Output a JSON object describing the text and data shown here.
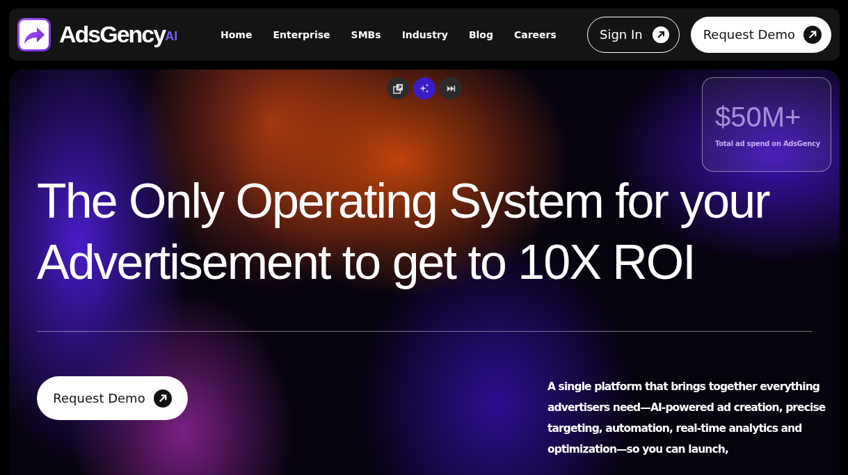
{
  "nav": {
    "brand": "AdsGency",
    "brand_badge": "AI",
    "links": [
      "Home",
      "Enterprise",
      "SMBs",
      "Industry",
      "Blog",
      "Careers"
    ],
    "sign_in": "Sign In",
    "request_demo": "Request Demo"
  },
  "hero": {
    "tools": [
      {
        "kind": "layers",
        "selected": false
      },
      {
        "kind": "sparkle",
        "selected": true
      },
      {
        "kind": "skip",
        "selected": false
      }
    ],
    "stat": {
      "value": "$50M+",
      "label": "Total ad spend on AdsGency"
    },
    "headline": [
      "The Only Operating System for your",
      "Advertisement to get to 10X ROI"
    ],
    "cta": "Request Demo",
    "description": "A single platform that brings together everything advertisers need—AI-powered ad creation, precise targeting, automation, real-time analytics and optimization—so you can launch,"
  }
}
